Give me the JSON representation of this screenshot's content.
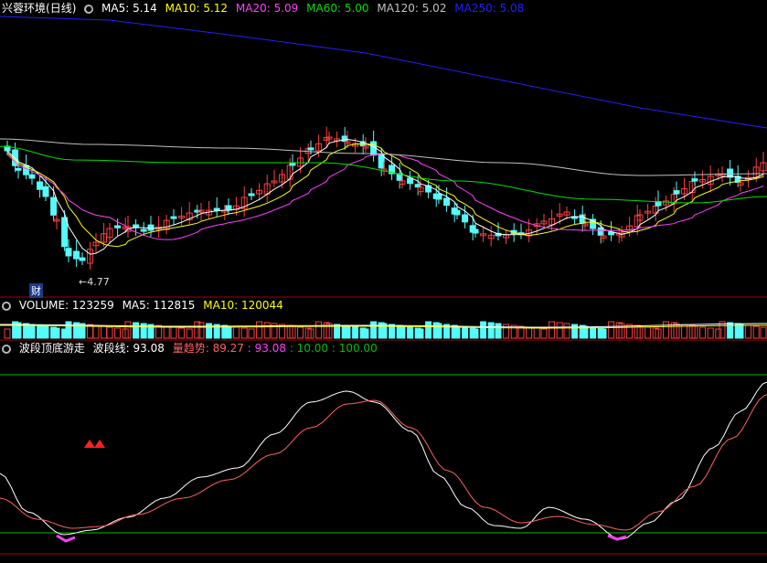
{
  "main_header": {
    "stock_name": "兴蓉环境",
    "period": "(日线)",
    "ma5": "MA5: 5.14",
    "ma10": "MA10: 5.12",
    "ma20": "MA20: 5.09",
    "ma60": "MA60: 5.00",
    "ma120": "MA120: 5.02",
    "ma250": "MA250: 5.08"
  },
  "low_label": "←4.77",
  "finance_badge": "财",
  "volume_header": {
    "volume": "VOLUME: 123259",
    "ma5": "MA5: 112815",
    "ma10": "MA10: 120044"
  },
  "indicator_header": {
    "name": "波段顶底游走",
    "wave_line": "波段线: 93.08",
    "trend": "量趋势: 89.27",
    "trend_value": ": 93.08",
    "level_low": ": 10.00",
    "level_high": ": 100.00"
  },
  "colors": {
    "up": "#ff4040",
    "down": "#54fcfc",
    "ma5": "#ffffff",
    "ma10": "#ffff00",
    "ma20": "#ff40ff",
    "ma60": "#00e000",
    "ma120": "#c0c0c0",
    "ma250": "#2020ff",
    "divider": "#a00000"
  }
}
